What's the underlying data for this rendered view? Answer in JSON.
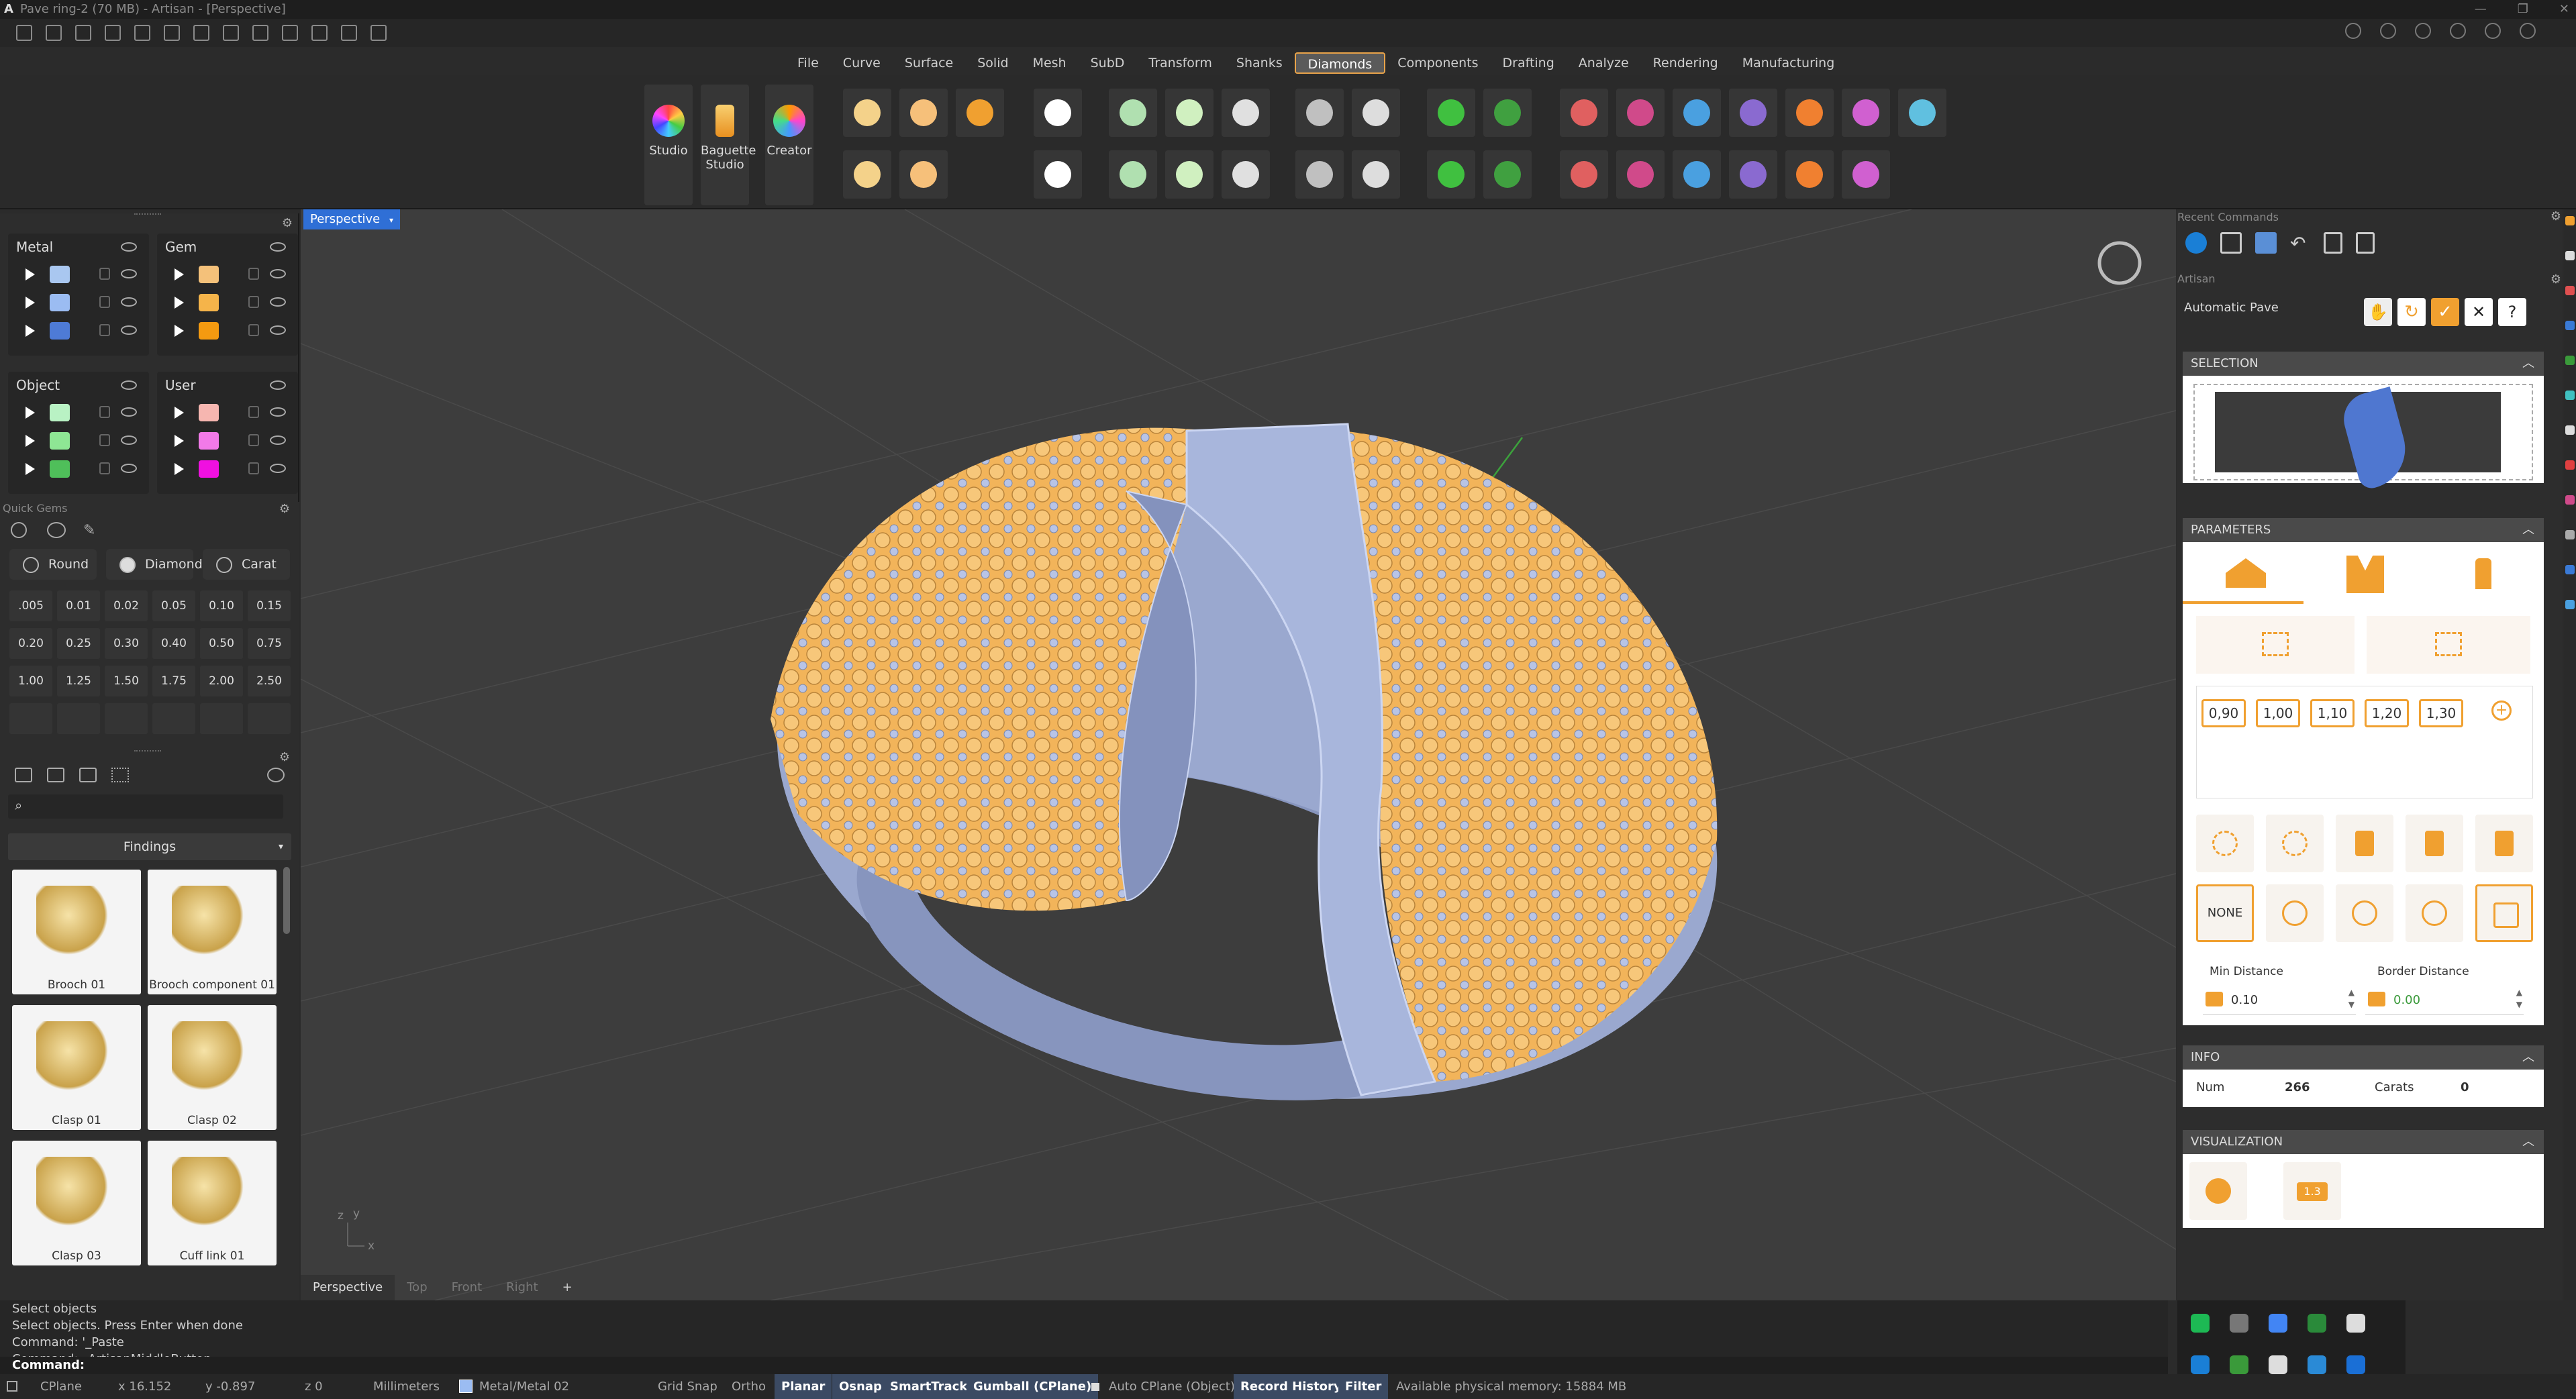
{
  "window": {
    "title": "Pave ring-2 (70 MB) - Artisan - [Perspective]",
    "logo": "A"
  },
  "menu": {
    "tabs": [
      "File",
      "Curve",
      "Surface",
      "Solid",
      "Mesh",
      "SubD",
      "Transform",
      "Shanks",
      "Diamonds",
      "Components",
      "Drafting",
      "Analyze",
      "Rendering",
      "Manufacturing"
    ],
    "active": "Diamonds"
  },
  "ribbon": {
    "big_buttons": [
      {
        "label": "Studio"
      },
      {
        "label": "Baguette\nStudio"
      },
      {
        "label": "Creator"
      }
    ]
  },
  "layers": {
    "groups": [
      {
        "title": "Metal",
        "swatches": [
          "#a9c7f0",
          "#9bbcf2",
          "#4e7bd6"
        ]
      },
      {
        "title": "Gem",
        "swatches": [
          "#f4c17a",
          "#f5b44a",
          "#f49a10"
        ]
      },
      {
        "title": "Object",
        "swatches": [
          "#b9f2c4",
          "#8ee694",
          "#4fbf5a"
        ]
      },
      {
        "title": "User",
        "swatches": [
          "#f6b6b0",
          "#f27ae8",
          "#f010e0"
        ]
      }
    ]
  },
  "quick_gems": {
    "title": "Quick Gems",
    "shape": "Round",
    "cut": "Diamond",
    "unit": "Carat",
    "sizes": [
      ".005",
      "0.01",
      "0.02",
      "0.05",
      "0.10",
      "0.15",
      "0.20",
      "0.25",
      "0.30",
      "0.40",
      "0.50",
      "0.75",
      "1.00",
      "1.25",
      "1.50",
      "1.75",
      "2.00",
      "2.50"
    ]
  },
  "library": {
    "category": "Findings",
    "search_placeholder": "",
    "items": [
      "Brooch 01",
      "Brooch component 01",
      "Clasp 01",
      "Clasp 02",
      "Clasp 03",
      "Cuff link 01"
    ]
  },
  "viewport": {
    "title": "Perspective",
    "tabs": [
      "Perspective",
      "Top",
      "Front",
      "Right"
    ],
    "axis": {
      "z": "z",
      "y": "y",
      "x": "x"
    }
  },
  "right_panel": {
    "recent_title": "Recent Commands",
    "artisan_title": "Artisan",
    "command": "Automatic Pave",
    "sections": {
      "selection": "SELECTION",
      "parameters": "PARAMETERS",
      "info": "INFO",
      "visualization": "VISUALIZATION"
    },
    "param_values": [
      "0,90",
      "1,00",
      "1,10",
      "1,20",
      "1,30"
    ],
    "none_label": "NONE",
    "min_distance_label": "Min Distance",
    "min_distance": "0.10",
    "border_distance_label": "Border Distance",
    "border_distance": "0.00",
    "info": {
      "num_label": "Num",
      "num": "266",
      "carats_label": "Carats",
      "carats": "0"
    },
    "viz_badge": "1.3"
  },
  "command_history": [
    "Select objects",
    "Select objects. Press Enter when done",
    "Command: '_Paste",
    "Command: _ArtisanMiddleButton"
  ],
  "command_prompt": "Command:",
  "status": {
    "cplane": "CPlane",
    "x": "x 16.152",
    "y": "y -0.897",
    "z": "z 0",
    "units": "Millimeters",
    "layer": "Metal/Metal 02",
    "grid_snap": "Grid Snap",
    "ortho": "Ortho",
    "planar": "Planar",
    "osnap": "Osnap",
    "smarttrack": "SmartTrack",
    "gumball": "Gumball (CPlane)",
    "auto_cplane": "Auto CPlane (Object)",
    "record_history": "Record History",
    "filter": "Filter",
    "memory": "Available physical memory: 15884 MB"
  }
}
